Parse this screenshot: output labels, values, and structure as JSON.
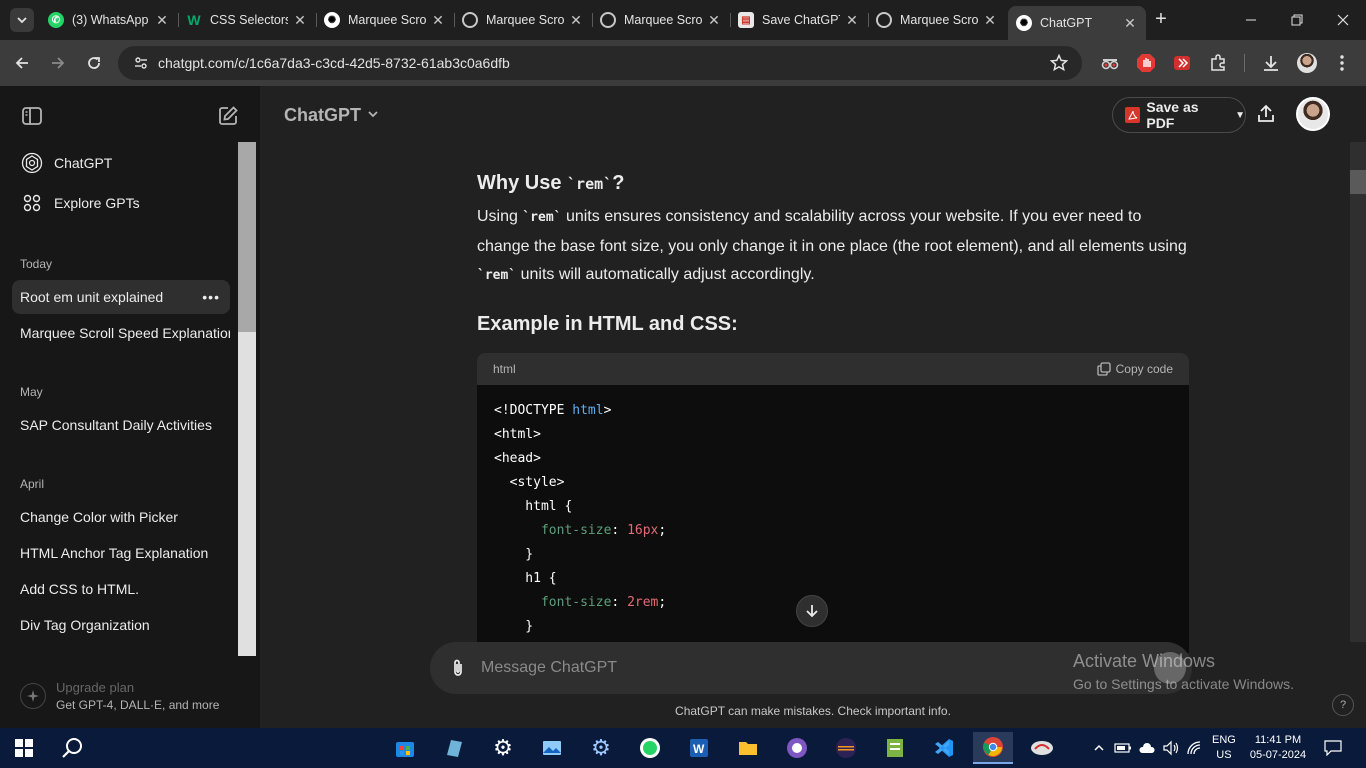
{
  "browser": {
    "tabs": [
      {
        "title": "(3) WhatsApp",
        "icon": "whatsapp-icon"
      },
      {
        "title": "CSS Selectors",
        "icon": "w3schools-icon"
      },
      {
        "title": "Marquee Scroll",
        "icon": "chatgpt-icon"
      },
      {
        "title": "Marquee Scroll",
        "icon": "globe-icon"
      },
      {
        "title": "Marquee Scroll",
        "icon": "globe-icon"
      },
      {
        "title": "Save ChatGPT",
        "icon": "save-chatgpt-icon"
      },
      {
        "title": "Marquee Scroll",
        "icon": "globe-icon"
      },
      {
        "title": "ChatGPT",
        "icon": "chatgpt-icon"
      }
    ],
    "url": "chatgpt.com/c/1c6a7da3-c3cd-42d5-8732-61ab3c0a6dfb"
  },
  "sidebar": {
    "nav": [
      {
        "label": "ChatGPT",
        "icon": "chatgpt-logo-icon"
      },
      {
        "label": "Explore GPTs",
        "icon": "grid-icon"
      }
    ],
    "sections": [
      {
        "title": "Today",
        "chats": [
          "Root em unit explained",
          "Marquee Scroll Speed Explanation"
        ]
      },
      {
        "title": "May",
        "chats": [
          "SAP Consultant Daily Activities"
        ]
      },
      {
        "title": "April",
        "chats": [
          "Change Color with Picker",
          "HTML Anchor Tag Explanation",
          "Add CSS to HTML.",
          "Div Tag Organization"
        ]
      }
    ],
    "upgrade": {
      "title": "Upgrade plan",
      "subtitle": "Get GPT-4, DALL·E, and more"
    }
  },
  "header": {
    "model": "ChatGPT",
    "save_pdf": "Save as PDF"
  },
  "content": {
    "heading1_prefix": "Why Use ",
    "heading1_code": "`rem`",
    "heading1_suffix": "?",
    "para_part1": "Using ",
    "para_code1": "`rem`",
    "para_part2": " units ensures consistency and scalability across your website. If you ever need to change the base font size, you only change it in one place (the root element), and all elements using ",
    "para_code2": "`rem`",
    "para_part3": " units will automatically adjust accordingly.",
    "heading2": "Example in HTML and CSS:",
    "code_lang": "html",
    "copy_label": "Copy code",
    "code": {
      "l1a": "<!DOCTYPE ",
      "l1b": "html",
      "l1c": ">",
      "l2": "<html>",
      "l3": "<head>",
      "l4": "  <style>",
      "l5": "    html {",
      "l6a": "      font-size",
      "l6b": ": ",
      "l6c": "16px",
      "l6d": ";",
      "l7": "    }",
      "l8": "    h1 {",
      "l9a": "      font-size",
      "l9b": ": ",
      "l9c": "2rem",
      "l9d": ";",
      "l10": "    }"
    }
  },
  "composer": {
    "placeholder": "Message ChatGPT"
  },
  "disclaimer": "ChatGPT can make mistakes. Check important info.",
  "help": "?",
  "watermark": {
    "line1": "Activate Windows",
    "line2": "Go to Settings to activate Windows."
  },
  "taskbar": {
    "lang1": "ENG",
    "lang2": "US",
    "time": "11:41 PM",
    "date": "05-07-2024"
  }
}
